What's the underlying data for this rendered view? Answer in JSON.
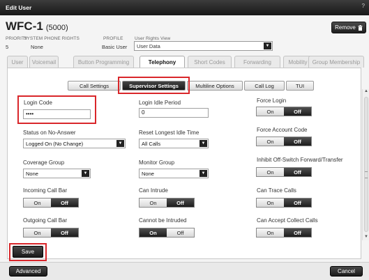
{
  "window": {
    "title": "Edit User",
    "help": "?"
  },
  "user": {
    "name": "WFC-1",
    "extension": "(5000)"
  },
  "header": {
    "remove_label": "Remove",
    "priority_label": "PRIORITY",
    "priority_value": "5",
    "sys_phone_label": "SYSTEM PHONE RIGHTS",
    "sys_phone_value": "None",
    "profile_label": "PROFILE",
    "profile_value": "Basic User",
    "rights_view_label": "User Rights View",
    "rights_view_value": "User Data"
  },
  "tabs": [
    "User",
    "Voicemail",
    "Button Programming",
    "Telephony",
    "Short Codes",
    "Forwarding",
    "Mobility",
    "Group Membership"
  ],
  "active_tab": "Telephony",
  "subtabs": [
    "Call Settings",
    "Supervisor Settings",
    "Multiline Options",
    "Call Log",
    "TUI"
  ],
  "active_subtab": "Supervisor Settings",
  "fields": {
    "login_code": {
      "label": "Login Code",
      "value": "••••"
    },
    "login_idle": {
      "label": "Login Idle Period",
      "value": "0"
    },
    "force_login": {
      "label": "Force Login",
      "state": "Off"
    },
    "status_no_answer": {
      "label": "Status on No-Answer",
      "value": "Logged On (No Change)"
    },
    "reset_idle": {
      "label": "Reset Longest Idle Time",
      "value": "All Calls"
    },
    "force_account": {
      "label": "Force Account Code",
      "state": "Off"
    },
    "coverage_group": {
      "label": "Coverage Group",
      "value": "None"
    },
    "monitor_group": {
      "label": "Monitor Group",
      "value": "None"
    },
    "inhibit_forward": {
      "label": "Inhibit Off-Switch Forward/Transfer",
      "state": "Off"
    },
    "incoming_bar": {
      "label": "Incoming Call Bar",
      "state": "Off"
    },
    "can_intrude": {
      "label": "Can Intrude",
      "state": "Off"
    },
    "can_trace": {
      "label": "Can Trace Calls",
      "state": "Off"
    },
    "outgoing_bar": {
      "label": "Outgoing Call Bar",
      "state": "Off"
    },
    "cannot_intruded": {
      "label": "Cannot be Intruded",
      "state": "On"
    },
    "accept_collect": {
      "label": "Can Accept Collect Calls",
      "state": "Off"
    }
  },
  "toggle_labels": {
    "on": "On",
    "off": "Off"
  },
  "buttons": {
    "save": "Save",
    "advanced": "Advanced",
    "cancel": "Cancel"
  },
  "colors": {
    "highlight": "#d9262a",
    "dark_button": "#1e1e1e"
  }
}
